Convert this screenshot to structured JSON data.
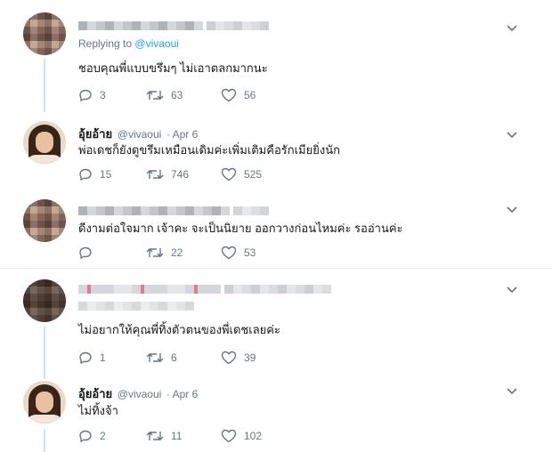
{
  "tweets": [
    {
      "name": "",
      "handle": "",
      "date": "",
      "replying_prefix": "Replying to",
      "replying_handle": "@vivaoui",
      "text": "ชอบคุณพี่แบบขรึมๆ   ไม่เอาตลกมากนะ",
      "replies": "3",
      "retweets": "63",
      "likes": "56"
    },
    {
      "name": "อุ้ยอ้าย",
      "handle": "@vivaoui",
      "date": "· Apr 6",
      "text": "พ่อเดชก็ยังดูขรึมเหมือนเดิมค่ะเพิ่มเติมคือรักเมียยิ่งนัก",
      "replies": "15",
      "retweets": "746",
      "likes": "525"
    },
    {
      "name": "",
      "handle": "",
      "date": "",
      "text": "ดีงามต่อใจมาก เจ้าคะ    จะเป็นนิยาย  ออกวางก่อนไหมค่ะ   รออ่านค่ะ",
      "replies": "",
      "retweets": "22",
      "likes": "53"
    },
    {
      "name": "",
      "handle": "",
      "date": "",
      "replying_prefix": "Replying to",
      "replying_handle": "",
      "text": "ไม่อยากให้คุณพี่ทิ้งตัวตนของพี่เดชเลยค่ะ",
      "replies": "1",
      "retweets": "6",
      "likes": "39"
    },
    {
      "name": "อุ้ยอ้าย",
      "handle": "@vivaoui",
      "date": "· Apr 6",
      "text": "ไม่ทิ้งจ้า",
      "replies": "2",
      "retweets": "11",
      "likes": "102"
    }
  ],
  "colors": {
    "accent": "#1da1f2",
    "thread": "#c4e4f7",
    "muted": "#657786",
    "divider": "#e6ecf0"
  },
  "icons": {
    "reply": "reply-icon",
    "retweet": "retweet-icon",
    "like": "heart-icon",
    "menu": "chevron-down-icon"
  }
}
